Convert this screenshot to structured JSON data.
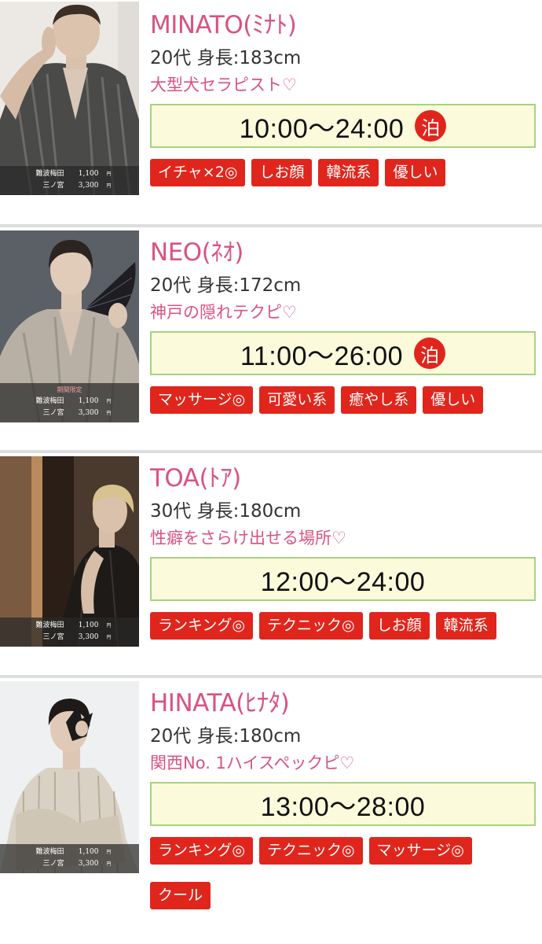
{
  "cast": [
    {
      "name": "MINATO(ﾐﾅﾄ)",
      "meta": "20代 身長:183cm",
      "catch": "大型犬セラピスト♡",
      "hours": "10:00〜24:00",
      "stay": "泊",
      "limited": "",
      "prices": [
        {
          "area": "難波梅田",
          "amount": "1,100",
          "yen": "円"
        },
        {
          "area": "三ノ宮",
          "amount": "3,300",
          "yen": "円"
        }
      ],
      "tags": [
        "イチャ×2◎",
        "しお顔",
        "韓流系",
        "優しい"
      ]
    },
    {
      "name": "NEO(ﾈｵ)",
      "meta": "20代 身長:172cm",
      "catch": "神戸の隠れテクピ♡",
      "hours": "11:00〜26:00",
      "stay": "泊",
      "limited": "期間限定",
      "prices": [
        {
          "area": "難波梅田",
          "amount": "1,100",
          "yen": "円"
        },
        {
          "area": "三ノ宮",
          "amount": "3,300",
          "yen": "円"
        }
      ],
      "tags": [
        "マッサージ◎",
        "可愛い系",
        "癒やし系",
        "優しい"
      ]
    },
    {
      "name": "TOA(ﾄｱ)",
      "meta": "30代 身長:180cm",
      "catch": "性癖をさらけ出せる場所♡",
      "hours": "12:00〜24:00",
      "stay": "",
      "limited": "",
      "prices": [
        {
          "area": "難波梅田",
          "amount": "1,100",
          "yen": "円"
        },
        {
          "area": "三ノ宮",
          "amount": "3,300",
          "yen": "円"
        }
      ],
      "tags": [
        "ランキング◎",
        "テクニック◎",
        "しお顔",
        "韓流系"
      ]
    },
    {
      "name": "HINATA(ﾋﾅﾀ)",
      "meta": "20代 身長:180cm",
      "catch": "関西No. 1ハイスペックピ♡",
      "hours": "13:00〜28:00",
      "stay": "",
      "limited": "",
      "prices": [
        {
          "area": "難波梅田",
          "amount": "1,100",
          "yen": "円"
        },
        {
          "area": "三ノ宮",
          "amount": "3,300",
          "yen": "円"
        }
      ],
      "tags": [
        "ランキング◎",
        "テクニック◎",
        "マッサージ◎",
        "クール"
      ]
    }
  ],
  "colors": {
    "name": "#d9537e",
    "tag_bg": "#e0261c",
    "hours_bg": "#fbfbdc",
    "hours_border": "#a6d37e"
  }
}
